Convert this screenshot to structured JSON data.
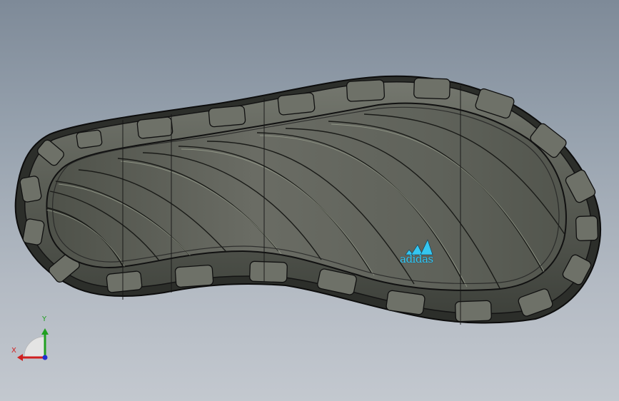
{
  "scene": {
    "model": "shoe-outsole",
    "background_top": "#7e8a98",
    "background_bottom": "#c3c8cf",
    "sole_color": "#5a5d55",
    "edge_color": "#111111"
  },
  "logo": {
    "text": "adidas",
    "color": "#35c6f0",
    "icon": "three-stripes-logo-icon"
  },
  "triad": {
    "x_label": "X",
    "y_label": "Y",
    "x_color": "#d02020",
    "y_color": "#20a020",
    "z_color": "#2030d0"
  }
}
